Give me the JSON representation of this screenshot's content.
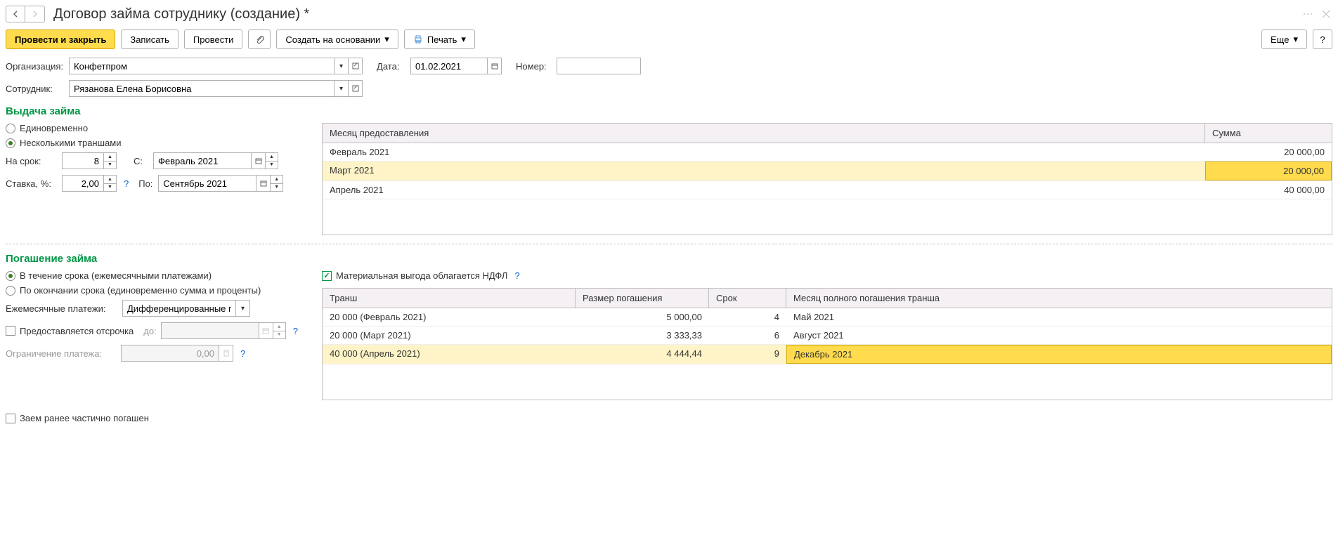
{
  "header": {
    "title": "Договор займа сотруднику (создание) *"
  },
  "toolbar": {
    "post_close": "Провести и закрыть",
    "save": "Записать",
    "post": "Провести",
    "create_based": "Создать на основании",
    "print": "Печать",
    "more": "Еще",
    "help": "?"
  },
  "main_form": {
    "org_label": "Организация:",
    "org_value": "Конфетпром",
    "date_label": "Дата:",
    "date_value": "01.02.2021",
    "number_label": "Номер:",
    "number_value": "",
    "employee_label": "Сотрудник:",
    "employee_value": "Рязанова Елена Борисовна"
  },
  "loan_issue": {
    "title": "Выдача займа",
    "option_once": "Единовременно",
    "option_tranches": "Несколькими траншами",
    "term_label": "На срок:",
    "term_value": "8",
    "from_label": "С:",
    "from_value": "Февраль 2021",
    "rate_label": "Ставка, %:",
    "rate_value": "2,00",
    "to_label": "По:",
    "to_value": "Сентябрь 2021",
    "table": {
      "col_month": "Месяц предоставления",
      "col_amount": "Сумма",
      "rows": [
        {
          "month": "Февраль 2021",
          "amount": "20 000,00"
        },
        {
          "month": "Март 2021",
          "amount": "20 000,00"
        },
        {
          "month": "Апрель 2021",
          "amount": "40 000,00"
        }
      ]
    }
  },
  "loan_repay": {
    "title": "Погашение займа",
    "option_during": "В течение срока (ежемесячными платежами)",
    "option_end": "По окончании срока (единовременно сумма и проценты)",
    "benefit_label": "Материальная выгода облагается НДФЛ",
    "monthly_label": "Ежемесячные платежи:",
    "monthly_value": "Дифференцированные пла",
    "defer_label": "Предоставляется отсрочка",
    "defer_to_label": "до:",
    "defer_value": "",
    "limit_label": "Ограничение платежа:",
    "limit_value": "0,00",
    "table": {
      "col_tranche": "Транш",
      "col_size": "Размер погашения",
      "col_term": "Срок",
      "col_month": "Месяц полного погашения транша",
      "rows": [
        {
          "tranche": "20 000  (Февраль 2021)",
          "size": "5 000,00",
          "term": "4",
          "month": "Май 2021"
        },
        {
          "tranche": "20 000  (Март 2021)",
          "size": "3 333,33",
          "term": "6",
          "month": "Август 2021"
        },
        {
          "tranche": "40 000  (Апрель 2021)",
          "size": "4 444,44",
          "term": "9",
          "month": "Декабрь 2021"
        }
      ]
    }
  },
  "footer": {
    "partially_repaid": "Заем ранее частично погашен"
  }
}
